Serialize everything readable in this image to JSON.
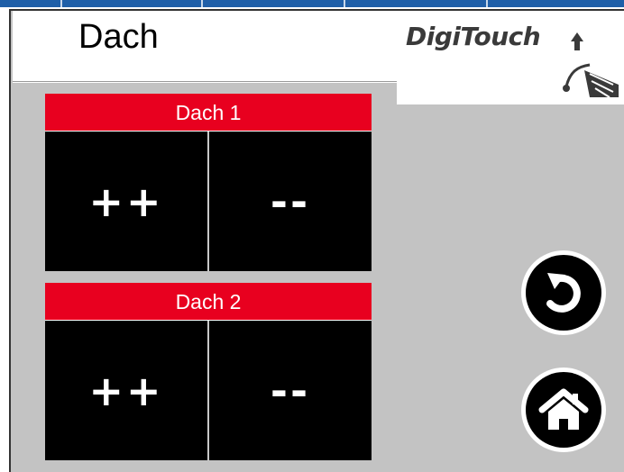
{
  "header": {
    "title": "Dach",
    "logo_text": "DigiTouch"
  },
  "groups": [
    {
      "label": "Dach 1",
      "increase_label": "++",
      "decrease_label": "--"
    },
    {
      "label": "Dach 2",
      "increase_label": "++",
      "decrease_label": "--"
    }
  ],
  "nav": {
    "back_icon": "undo-arrow-icon",
    "home_icon": "home-icon"
  },
  "colors": {
    "accent_red": "#e8001f",
    "panel_gray": "#c3c3c3",
    "button_black": "#000000",
    "top_strip_blue": "#1f5fa8"
  }
}
